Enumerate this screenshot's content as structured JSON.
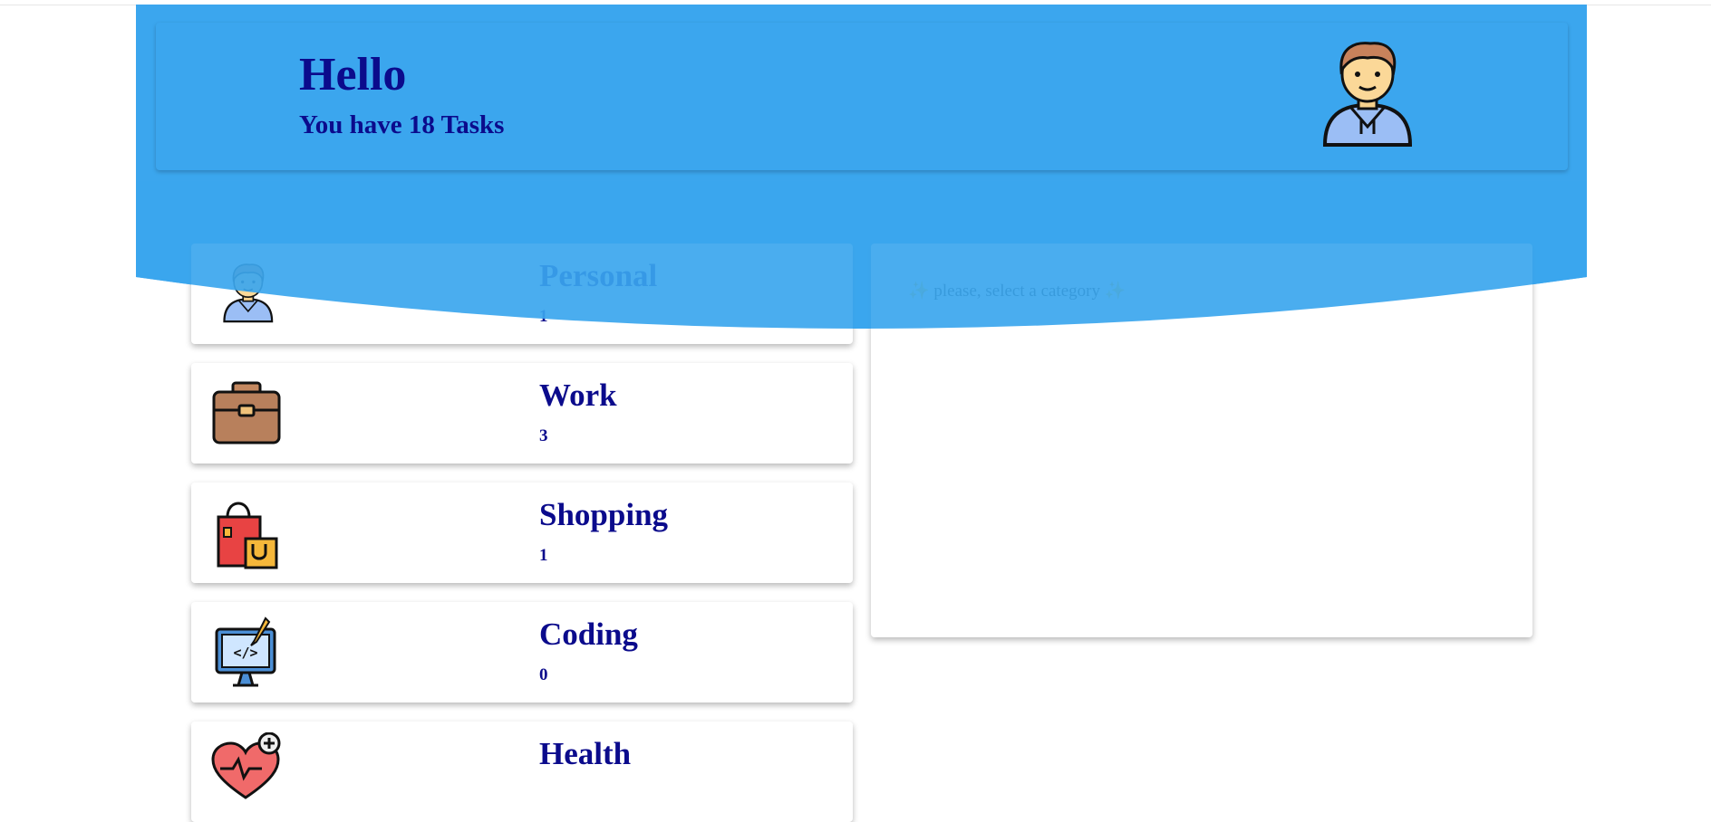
{
  "colors": {
    "hero_blue": "#3ba6ee",
    "text_navy": "#0b0b8c"
  },
  "header": {
    "greeting": "Hello",
    "subtitle": "You have 18 Tasks",
    "avatar_icon": "user-avatar-icon"
  },
  "categories": [
    {
      "label": "Personal",
      "count": "1",
      "icon": "person-icon"
    },
    {
      "label": "Work",
      "count": "3",
      "icon": "briefcase-icon"
    },
    {
      "label": "Shopping",
      "count": "1",
      "icon": "shopping-bags-icon"
    },
    {
      "label": "Coding",
      "count": "0",
      "icon": "computer-code-icon"
    },
    {
      "label": "Health",
      "count": "",
      "icon": "health-heart-icon"
    }
  ],
  "detail": {
    "message": "✨ please, select a category ✨"
  }
}
